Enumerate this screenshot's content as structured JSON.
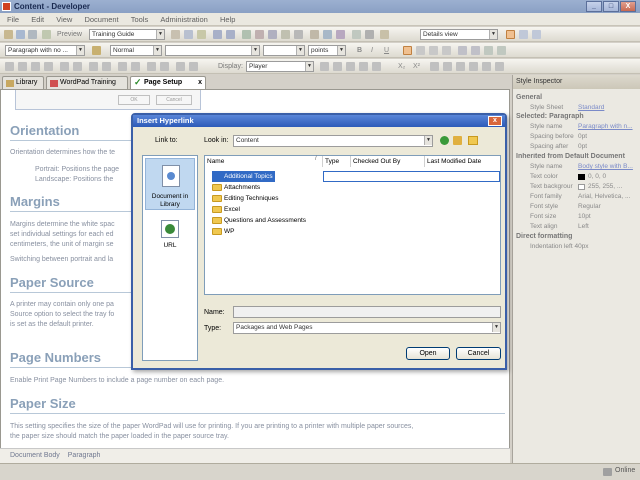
{
  "window": {
    "title": "Content - Developer",
    "minimize": "_",
    "maximize": "□",
    "close": "X"
  },
  "menu": [
    "File",
    "Edit",
    "View",
    "Document",
    "Tools",
    "Administration",
    "Help"
  ],
  "toolbar1": {
    "preview_label": "Preview",
    "stylesheet_value": "Training Guide",
    "view_value": "Details view"
  },
  "toolbar2": {
    "paragraph_style": "Paragraph with no ...",
    "font_style": "Normal",
    "font_name": "",
    "font_size": "",
    "units": "points",
    "bold": "B",
    "italic": "I",
    "underline": "U"
  },
  "toolbar3": {
    "display_label": "Display:",
    "display_value": "Player",
    "subscript": "X₂",
    "superscript": "X²"
  },
  "tabs": [
    {
      "label": "Library",
      "active": false
    },
    {
      "label": "WordPad Training",
      "active": false
    },
    {
      "label": "Page Setup",
      "active": true
    }
  ],
  "tab_close": "x",
  "doc": {
    "ghost_ok": "OK",
    "ghost_cancel": "Cancel",
    "h_orientation": "Orientation",
    "p_orientation": "Orientation determines how the te",
    "p_portrait": "Portrait: Positions the page",
    "p_landscape": "Landscape: Positions the",
    "h_margins": "Margins",
    "p_margins1": "Margins determine the white spac",
    "p_margins2": "set individual settings for each ed",
    "p_margins3": "centimeters, the unit of margin se",
    "p_switching": "Switching between portrait and la",
    "h_source": "Paper Source",
    "p_source1": "A printer may contain only one pa",
    "p_source2": "Source option to select the tray fo",
    "p_source3": "is set as the default printer.",
    "h_pagenum": "Page Numbers",
    "p_pagenum": "Enable Print Page Numbers to include a page number on each page.",
    "h_size": "Paper Size",
    "p_size1": "This setting specifies the size of the paper WordPad will use for printing. If you are printing to a printer with multiple paper sources,",
    "p_size2": "the paper size should match the paper loaded in the paper source tray."
  },
  "doc_status": {
    "item1": "Document Body",
    "item2": "Paragraph"
  },
  "inspector": {
    "title": "Style Inspector",
    "general": "General",
    "stylesheet_label": "Style Sheet",
    "stylesheet_value": "Standard",
    "selected": "Selected: Paragraph",
    "sel_rows": [
      {
        "label": "Style name",
        "value": "Paragraph with n..."
      },
      {
        "label": "Spacing before",
        "value": "0pt"
      },
      {
        "label": "Spacing after",
        "value": "0pt"
      }
    ],
    "inherited": "Inherited from Default Document",
    "inh_rows": [
      {
        "label": "Style name",
        "value": "Body style with B..."
      },
      {
        "label": "Text color",
        "value": "0, 0, 0"
      },
      {
        "label": "Text backgrour",
        "value": "255, 255, ..."
      },
      {
        "label": "Font family",
        "value": "Arial, Helvetica, ..."
      },
      {
        "label": "Font style",
        "value": "Regular"
      },
      {
        "label": "Font size",
        "value": "10pt"
      },
      {
        "label": "Text align",
        "value": "Left"
      }
    ],
    "direct": "Direct formatting",
    "direct_rows": [
      {
        "label": "Indentation left 40px"
      }
    ]
  },
  "status_online": "Online",
  "dialog": {
    "title": "Insert Hyperlink",
    "close": "x",
    "link_to_label": "Link to:",
    "look_in_label": "Look in:",
    "look_in_value": "Content",
    "link_options": [
      {
        "label": "Document in Library",
        "selected": true
      },
      {
        "label": "URL",
        "selected": false
      }
    ],
    "columns": [
      "Name",
      "Type",
      "Checked Out By",
      "Last Modified Date"
    ],
    "files": [
      {
        "name": "Additional Topics",
        "selected": true
      },
      {
        "name": "Attachments",
        "selected": false
      },
      {
        "name": "Editing Techniques",
        "selected": false
      },
      {
        "name": "Excel",
        "selected": false
      },
      {
        "name": "Questions and Assessments",
        "selected": false
      },
      {
        "name": "WP",
        "selected": false
      }
    ],
    "name_label": "Name:",
    "name_value": "",
    "type_label": "Type:",
    "type_value": "Packages and Web Pages",
    "open_button": "Open",
    "cancel_button": "Cancel"
  },
  "colors": {
    "accent": "#316ac5",
    "heading": "#8aa0b8",
    "dialog_border": "#3a5fa8"
  }
}
